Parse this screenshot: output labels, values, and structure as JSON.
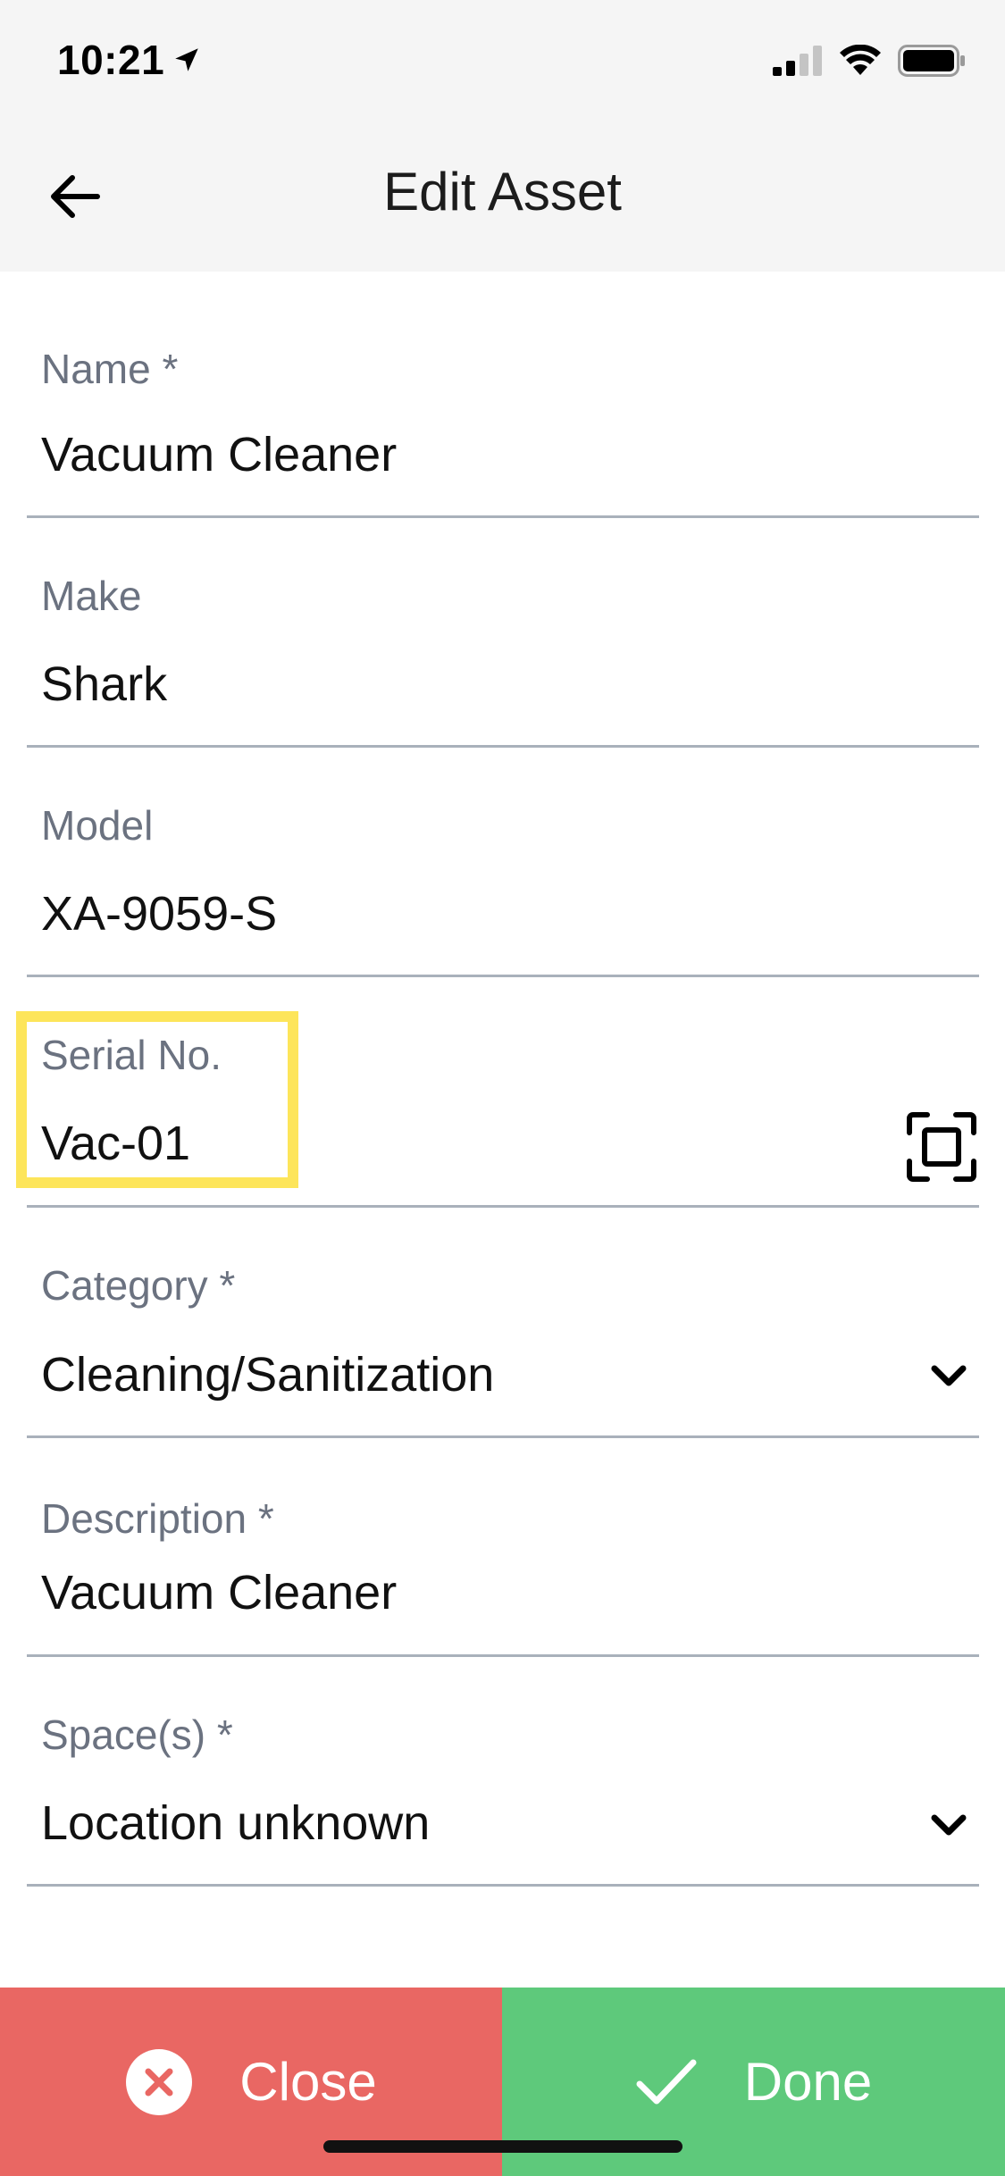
{
  "status_bar": {
    "time": "10:21"
  },
  "header": {
    "title": "Edit Asset"
  },
  "form": {
    "name": {
      "label": "Name *",
      "value": "Vacuum Cleaner"
    },
    "make": {
      "label": "Make",
      "value": "Shark"
    },
    "model": {
      "label": "Model",
      "value": "XA-9059-S"
    },
    "serial_no": {
      "label": "Serial No.",
      "value": "Vac-01"
    },
    "category": {
      "label": "Category *",
      "value": "Cleaning/Sanitization"
    },
    "description": {
      "label": "Description *",
      "value": "Vacuum Cleaner"
    },
    "spaces": {
      "label": "Space(s) *",
      "value": "Location unknown"
    }
  },
  "footer": {
    "close_label": "Close",
    "done_label": "Done"
  },
  "colors": {
    "close": "#e96763",
    "done": "#5ec97b",
    "highlight": "#fde55a",
    "header_bg": "#f5f5f5"
  },
  "icons": {
    "back": "arrow-left-icon",
    "scan": "scan-frame-icon",
    "dropdown": "chevron-down-icon",
    "close": "x-circle-icon",
    "done": "checkmark-icon"
  }
}
